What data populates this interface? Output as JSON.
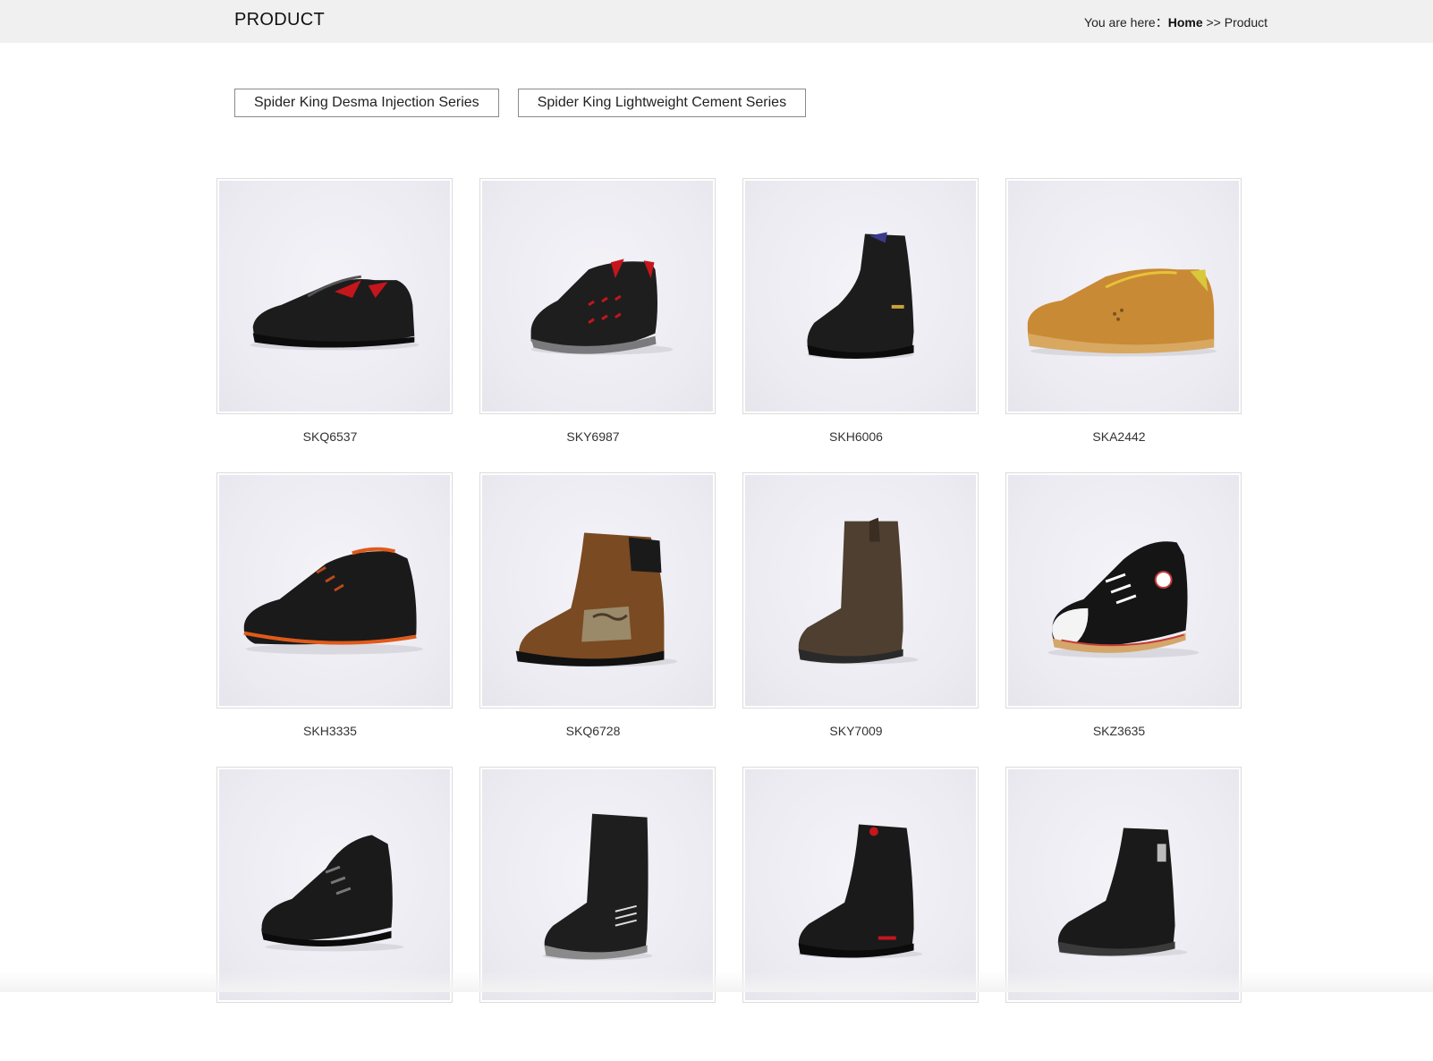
{
  "header": {
    "title": "PRODUCT",
    "breadcrumb_prefix": "You are here：",
    "breadcrumb_home": "Home",
    "breadcrumb_sep": " >> ",
    "breadcrumb_current": "Product"
  },
  "tabs": [
    {
      "label": "Spider King Desma Injection Series"
    },
    {
      "label": "Spider King Lightweight Cement Series"
    }
  ],
  "products": [
    {
      "name": "SKQ6537",
      "icon": "black-low-shoe-red-accent-icon"
    },
    {
      "name": "SKY6987",
      "icon": "black-low-shoe-red-lining-icon"
    },
    {
      "name": "SKH6006",
      "icon": "black-tall-boot-icon"
    },
    {
      "name": "SKA2442",
      "icon": "tan-low-shoe-icon"
    },
    {
      "name": "SKH3335",
      "icon": "black-mid-boot-orange-trim-icon"
    },
    {
      "name": "SKQ6728",
      "icon": "brown-camo-tall-boot-icon"
    },
    {
      "name": "SKY7009",
      "icon": "brown-rigger-boot-icon"
    },
    {
      "name": "SKZ3635",
      "icon": "black-canvas-sneaker-icon"
    },
    {
      "name": "",
      "icon": "black-hiker-boot-icon"
    },
    {
      "name": "",
      "icon": "black-rigger-boot-icon"
    },
    {
      "name": "",
      "icon": "black-tall-boot-red-icon"
    },
    {
      "name": "",
      "icon": "black-tall-boot-side-zip-icon"
    }
  ],
  "colors": {
    "topbar_bg": "#f0f0f0",
    "image_bg": "#ecebf2",
    "border": "#dcdcdc"
  }
}
